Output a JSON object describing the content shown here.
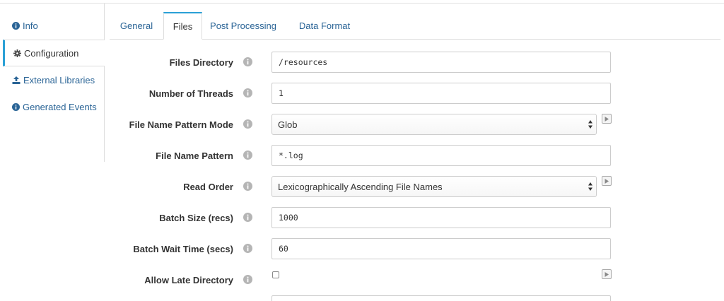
{
  "sidebar": {
    "items": [
      {
        "label": "Info",
        "icon": "info-circle-icon"
      },
      {
        "label": "Configuration",
        "icon": "gear-icon"
      },
      {
        "label": "External Libraries",
        "icon": "upload-icon"
      },
      {
        "label": "Generated Events",
        "icon": "info-circle-icon"
      }
    ],
    "active_index": 1
  },
  "tabs": {
    "items": [
      "General",
      "Files",
      "Post Processing",
      "Data Format"
    ],
    "active_index": 1
  },
  "form": {
    "files_directory": {
      "label": "Files Directory",
      "value": "/resources"
    },
    "number_of_threads": {
      "label": "Number of Threads",
      "value": "1"
    },
    "file_name_pattern_mode": {
      "label": "File Name Pattern Mode",
      "value": "Glob"
    },
    "file_name_pattern": {
      "label": "File Name Pattern",
      "value": "*.log"
    },
    "read_order": {
      "label": "Read Order",
      "value": "Lexicographically Ascending File Names"
    },
    "batch_size": {
      "label": "Batch Size (recs)",
      "value": "1000"
    },
    "batch_wait_time": {
      "label": "Batch Wait Time (secs)",
      "value": "60"
    },
    "allow_late_directory": {
      "label": "Allow Late Directory",
      "checked": false
    }
  },
  "colors": {
    "accent": "#2aa0d6",
    "link": "#2a6496",
    "border": "#cccccc",
    "info_icon": "#b5b5b5"
  }
}
